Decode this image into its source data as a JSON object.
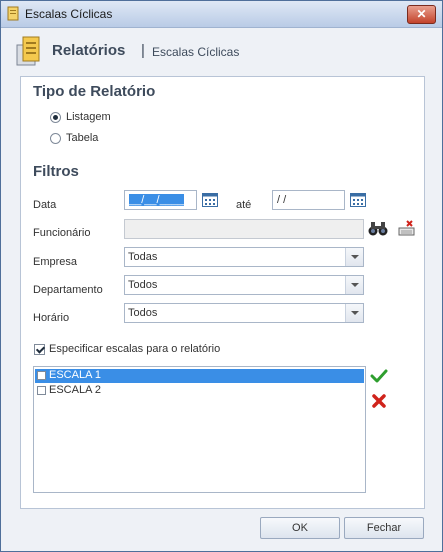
{
  "window": {
    "title": "Escalas Cíclicas",
    "close_glyph": "✕"
  },
  "header": {
    "title": "Relatórios",
    "separator": "|",
    "subtitle": "Escalas Cíclicas"
  },
  "report_type": {
    "heading": "Tipo de Relatório",
    "options": [
      {
        "label": "Listagem",
        "selected": true
      },
      {
        "label": "Tabela",
        "selected": false
      }
    ]
  },
  "filters": {
    "heading": "Filtros",
    "date_label": "Data",
    "date_from": "__/__/____",
    "until_label": "até",
    "date_to": "/ /",
    "employee_label": "Funcionário",
    "employee_value": "",
    "company_label": "Empresa",
    "company_value": "Todas",
    "department_label": "Departamento",
    "department_value": "Todos",
    "schedule_label": "Horário",
    "schedule_value": "Todos"
  },
  "specify": {
    "label": "Especificar escalas para o relatório",
    "checked": true
  },
  "scales": [
    {
      "label": "ESCALA 1",
      "selected": true,
      "checked": false
    },
    {
      "label": "ESCALA 2",
      "selected": false,
      "checked": false
    }
  ],
  "buttons": {
    "ok": "OK",
    "close": "Fechar"
  },
  "icons": {
    "window": "report-icon",
    "header": "document-stack-icon",
    "calendar": "calendar-icon",
    "search": "binoculars-icon",
    "clear": "eraser-icon",
    "check_all": "green-check-icon",
    "uncheck_all": "red-x-icon"
  },
  "colors": {
    "accent": "#3a8ee6",
    "title": "#3e4b5c",
    "confirm": "#2e9e2e",
    "cancel": "#d0231b"
  }
}
